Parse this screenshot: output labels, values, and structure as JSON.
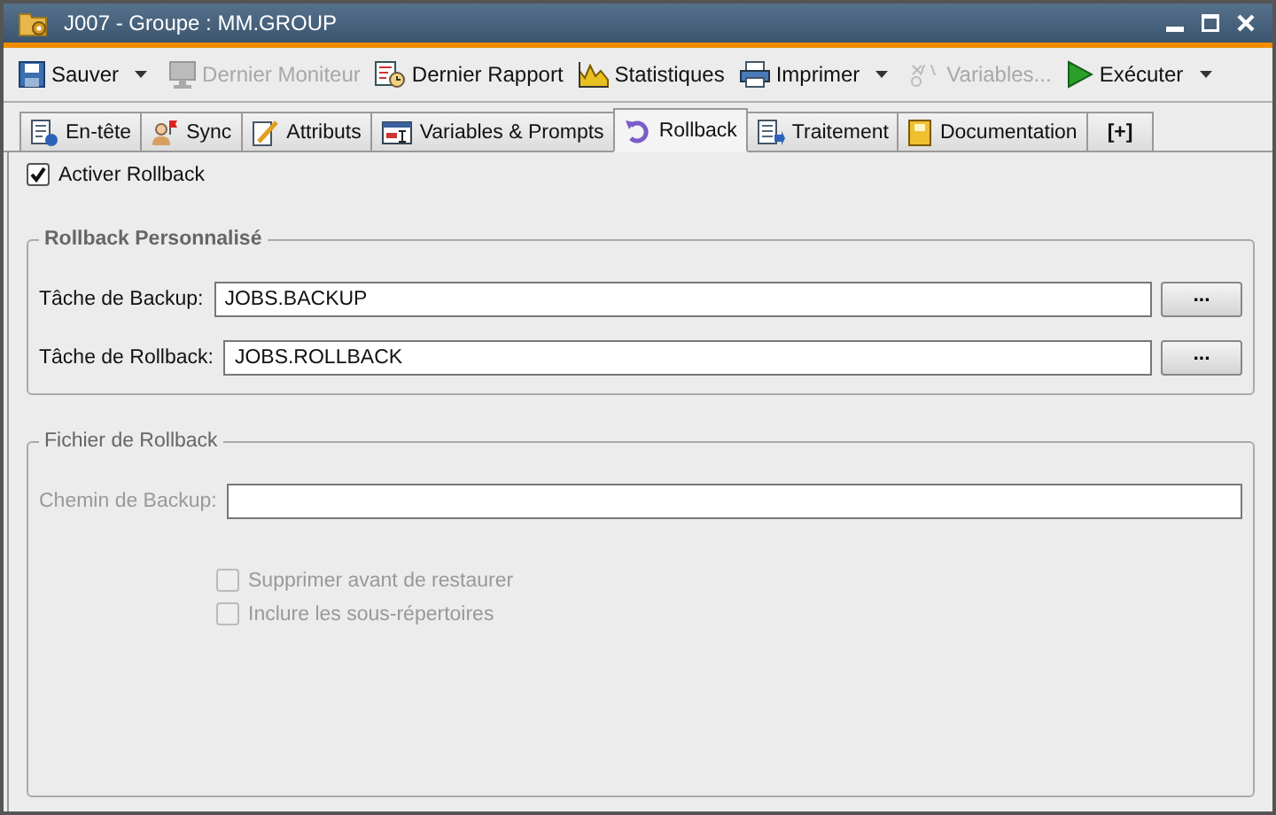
{
  "window": {
    "title": "J007 - Groupe : MM.GROUP"
  },
  "toolbar": [
    {
      "kind": "save",
      "label": "Sauver",
      "disabled": false,
      "dropdown": true
    },
    {
      "kind": "monitor",
      "label": "Dernier Moniteur",
      "disabled": true,
      "dropdown": false
    },
    {
      "kind": "report",
      "label": "Dernier Rapport",
      "disabled": false,
      "dropdown": false
    },
    {
      "kind": "stats",
      "label": "Statistiques",
      "disabled": false,
      "dropdown": false
    },
    {
      "kind": "print",
      "label": "Imprimer",
      "disabled": false,
      "dropdown": true
    },
    {
      "kind": "variables",
      "label": "Variables...",
      "disabled": true,
      "dropdown": false
    },
    {
      "kind": "run",
      "label": "Exécuter",
      "disabled": false,
      "dropdown": true
    }
  ],
  "tabs": [
    {
      "kind": "info",
      "label": "En-tête",
      "selected": false
    },
    {
      "kind": "sync",
      "label": "Sync",
      "selected": false
    },
    {
      "kind": "edit",
      "label": "Attributs",
      "selected": false
    },
    {
      "kind": "vars",
      "label": "Variables & Prompts",
      "selected": false
    },
    {
      "kind": "rollback",
      "label": "Rollback",
      "selected": true
    },
    {
      "kind": "process",
      "label": "Traitement",
      "selected": false
    },
    {
      "kind": "doc",
      "label": "Documentation",
      "selected": false
    },
    {
      "kind": "text",
      "label": "[+]",
      "selected": false
    }
  ],
  "activate": {
    "label": "Activer Rollback",
    "checked": true
  },
  "groups": [
    {
      "title": "Rollback Personnalisé",
      "disabled": false,
      "rows": [
        {
          "label": "Tâche de Backup:",
          "value": "JOBS.BACKUP",
          "button": "..."
        },
        {
          "label": "Tâche de Rollback:",
          "value": "JOBS.ROLLBACK",
          "button": "..."
        }
      ]
    },
    {
      "title": "Fichier de Rollback",
      "disabled": true,
      "rows": [
        {
          "label": "Chemin de Backup:"
        }
      ],
      "options": [
        {
          "label": "Supprimer avant de restaurer",
          "checked": false
        },
        {
          "label": "Inclure les sous-répertoires",
          "checked": false
        }
      ]
    }
  ]
}
